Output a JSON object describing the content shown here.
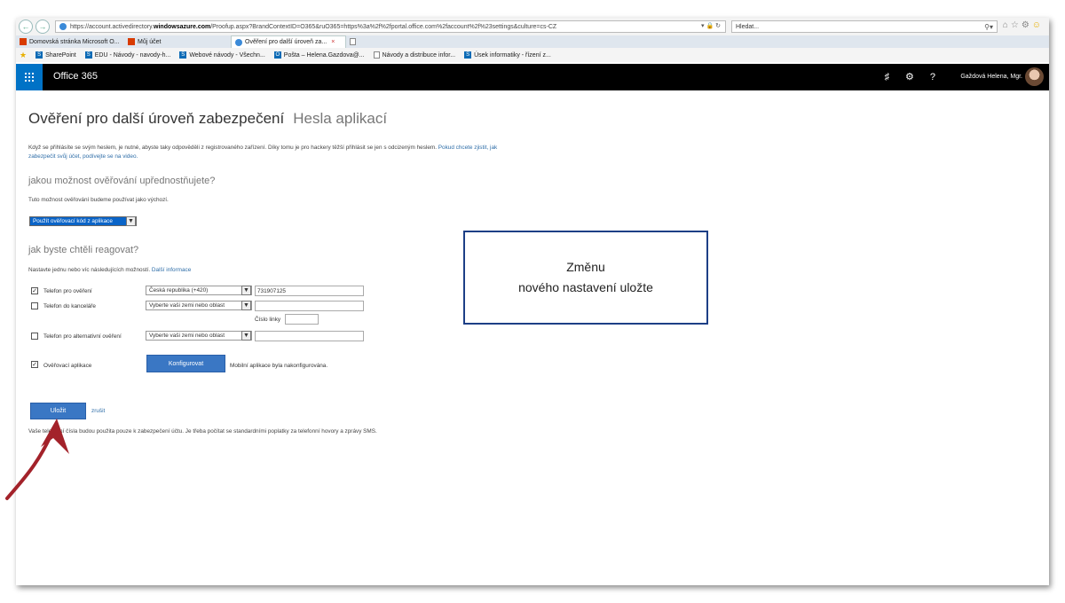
{
  "browser": {
    "url_prefix": "https://account.activedirectory.",
    "url_domain": "windowsazure.com",
    "url_rest": "/Proofup.aspx?BrandContextID=O365&ruO365=https%3a%2f%2fportal.office.com%2faccount%2f%23settings&culture=cs-CZ",
    "search_placeholder": "Hledat...",
    "tabs": [
      {
        "label": "Domovská stránka Microsoft O..."
      },
      {
        "label": "Můj účet"
      },
      {
        "label": "Ověření pro další úroveň za..."
      }
    ],
    "favorites": [
      {
        "label": "SharePoint"
      },
      {
        "label": "EDU - Návody - navody-h..."
      },
      {
        "label": "Webové návody - Všechn..."
      },
      {
        "label": "Pošta – Helena.Gazdova@..."
      },
      {
        "label": "Návody a distribuce infor..."
      },
      {
        "label": "Úsek informatiky - řízení z..."
      }
    ]
  },
  "o365": {
    "brand": "Office 365",
    "user_name": "Gaždová Helena, Mgr."
  },
  "page": {
    "title": "Ověření pro další úroveň zabezpečení",
    "title_secondary": "Hesla aplikací",
    "intro_text": "Když se přihlásíte se svým heslem, je nutné, abyste taky odpověděli z registrovaného zařízení. Díky tomu je pro hackery těžší přihlásit se jen s odcizeným heslem.",
    "intro_link": "Pokud chcete zjistit, jak zabezpečit svůj účet, podívejte se na video.",
    "q1": "jakou možnost ověřování upřednostňujete?",
    "q1_desc": "Tuto možnost ověřování budeme používat jako výchozí.",
    "q1_selected": "Použít ověřovací kód z aplikace",
    "q2": "jak byste chtěli reagovat?",
    "q2_desc": "Nastavte jednu nebo víc následujících možností.",
    "q2_link": "Další informace",
    "options": {
      "phone_label": "Telefon pro ověření",
      "phone_country": "Česká republika (+420)",
      "phone_number": "731907125",
      "office_label": "Telefon do kanceláře",
      "office_country": "Vyberte vaši zemi nebo oblast",
      "extension_label": "Číslo linky",
      "alt_label": "Telefon pro alternativní ověření",
      "alt_country": "Vyberte vaši zemi nebo oblast",
      "app_label": "Ověřovací aplikace",
      "configure_button": "Konfigurovat",
      "app_status": "Mobilní aplikace byla nakonfigurována."
    },
    "save_button": "Uložit",
    "cancel_link": "zrušit",
    "footer_text": "Vaše telefonní čísla budou použita pouze k zabezpečení účtu. Je třeba počítat se standardními poplatky za telefonní hovory a zprávy SMS."
  },
  "callout": {
    "line1": "Změnu",
    "line2": "nového nastavení uložte"
  },
  "colors": {
    "accent": "#0072c6",
    "button": "#3a77c4",
    "callout_border": "#1d3f86",
    "arrow": "#a3222a"
  }
}
